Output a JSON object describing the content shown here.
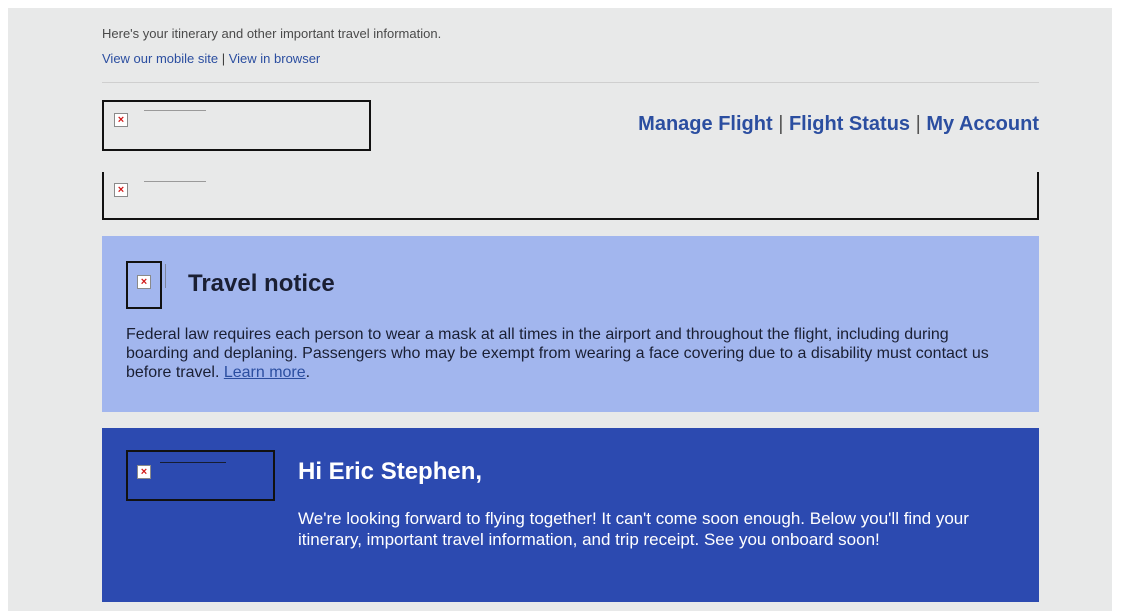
{
  "preheader": {
    "intro": "Here's your itinerary and other important travel information.",
    "mobile_link": "View our mobile site",
    "separator": "|",
    "browser_link": "View in browser"
  },
  "nav": {
    "manage_flight": "Manage Flight",
    "flight_status": "Flight Status",
    "my_account": "My Account",
    "separator": "|"
  },
  "broken_image_glyph": "×",
  "travel_notice": {
    "title": "Travel notice",
    "body": "Federal law requires each person to wear a mask at all times in the airport and throughout the flight, including during boarding and deplaning. Passengers who may be exempt from wearing a face covering due to a disability must contact us before travel. ",
    "link": "Learn more",
    "trailing": "."
  },
  "greeting": {
    "title": "Hi Eric Stephen,",
    "body": "We're looking forward to flying together! It can't come soon enough. Below you'll find your itinerary, important travel information, and trip receipt. See you onboard soon!"
  },
  "colors": {
    "page_bg": "#e8e9e9",
    "link": "#2b4ea0",
    "notice_bg": "#a2b6ee",
    "greeting_bg": "#2c4ab0",
    "broken_x": "#d01818"
  }
}
